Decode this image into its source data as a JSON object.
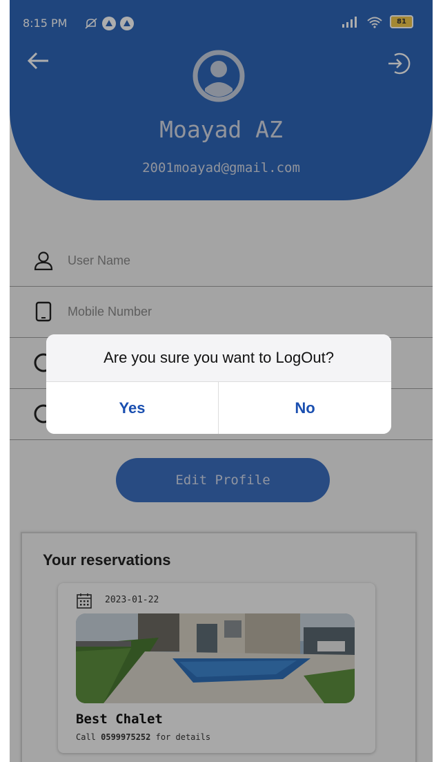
{
  "status_bar": {
    "time": "8:15 PM",
    "battery": "81"
  },
  "profile": {
    "name": "Moayad AZ",
    "email": "2001moayad@gmail.com"
  },
  "fields": {
    "username_placeholder": "User Name",
    "mobile_placeholder": "Mobile Number"
  },
  "edit_button": "Edit Profile",
  "reservations": {
    "title": "Your reservations",
    "items": [
      {
        "date": "2023-01-22",
        "name": "Best Chalet",
        "call_prefix": "Call ",
        "phone": "0599975252",
        "call_suffix": " for details"
      }
    ]
  },
  "dialog": {
    "message": "Are you sure you want to LogOut?",
    "yes": "Yes",
    "no": "No"
  },
  "colors": {
    "header": "#2f66b8",
    "button": "#3b6fc0",
    "dialog_action": "#1a4fb0"
  },
  "icons": [
    "back-arrow-icon",
    "logout-icon",
    "avatar-icon",
    "person-icon",
    "phone-icon",
    "calendar-icon"
  ]
}
